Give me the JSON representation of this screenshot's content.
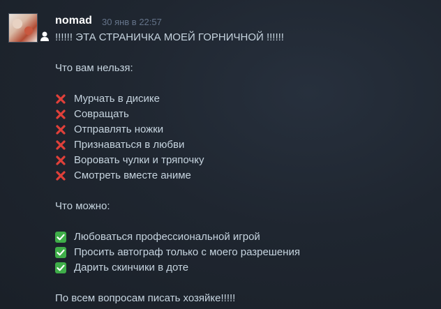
{
  "comment": {
    "author": "nomad",
    "timestamp": "30 янв в 22:57",
    "headline": "!!!!!! ЭТА СТРАНИЧКА МОЕЙ ГОРНИЧНОЙ !!!!!!",
    "forbidden_heading": "Что вам нельзя:",
    "forbidden_items": [
      "Мурчать в дисике",
      "Совращать",
      "Отправлять ножки",
      "Признаваться в любви",
      "Воровать чулки и тряпочку",
      "Смотреть вместе аниме"
    ],
    "allowed_heading": "Что можно:",
    "allowed_items": [
      "Любоваться профессиональной игрой",
      "Просить автограф только с моего разрешения",
      "Дарить скинчики в доте"
    ],
    "footer": "По всем вопросам писать хозяйке!!!!!"
  },
  "icons": {
    "forbidden_marker": "cross-icon",
    "allowed_marker": "check-icon",
    "status": "user-status-icon"
  },
  "colors": {
    "cross": "#e0403a",
    "check": "#3fae49",
    "author": "#ffffff",
    "timestamp": "#65748a",
    "text": "#c6d4df"
  }
}
